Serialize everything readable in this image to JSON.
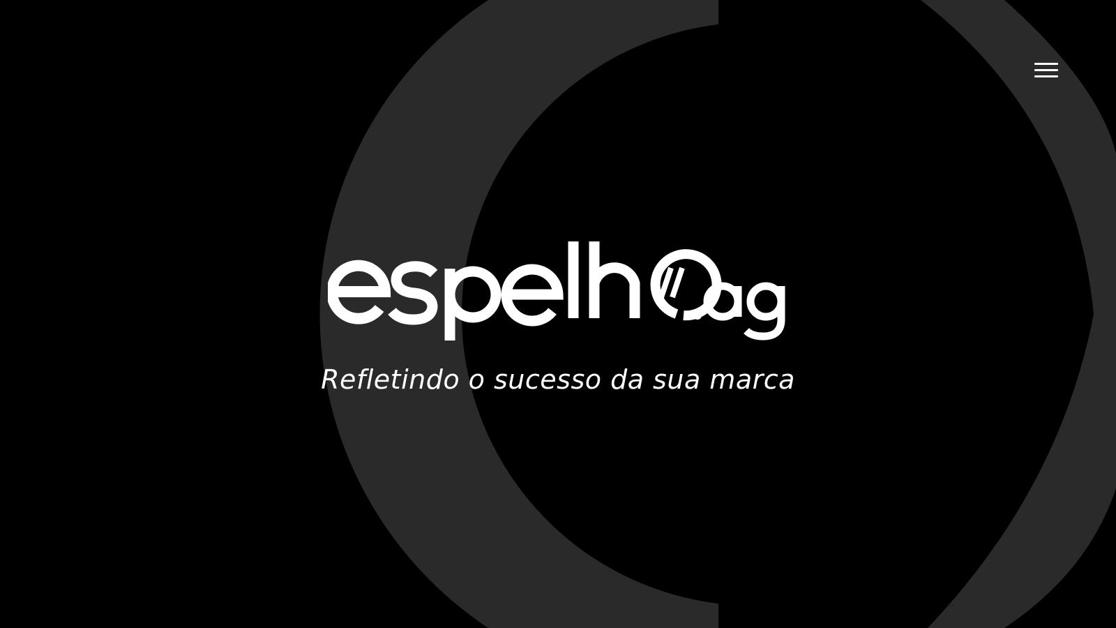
{
  "brand": {
    "logo_text": "espelho.ag",
    "tagline": "Refletindo o sucesso da sua marca"
  },
  "header": {
    "menu_icon": "hamburger-menu-icon"
  },
  "colors": {
    "background": "#000000",
    "ring": "#2a2a2a",
    "foreground": "#ffffff"
  }
}
